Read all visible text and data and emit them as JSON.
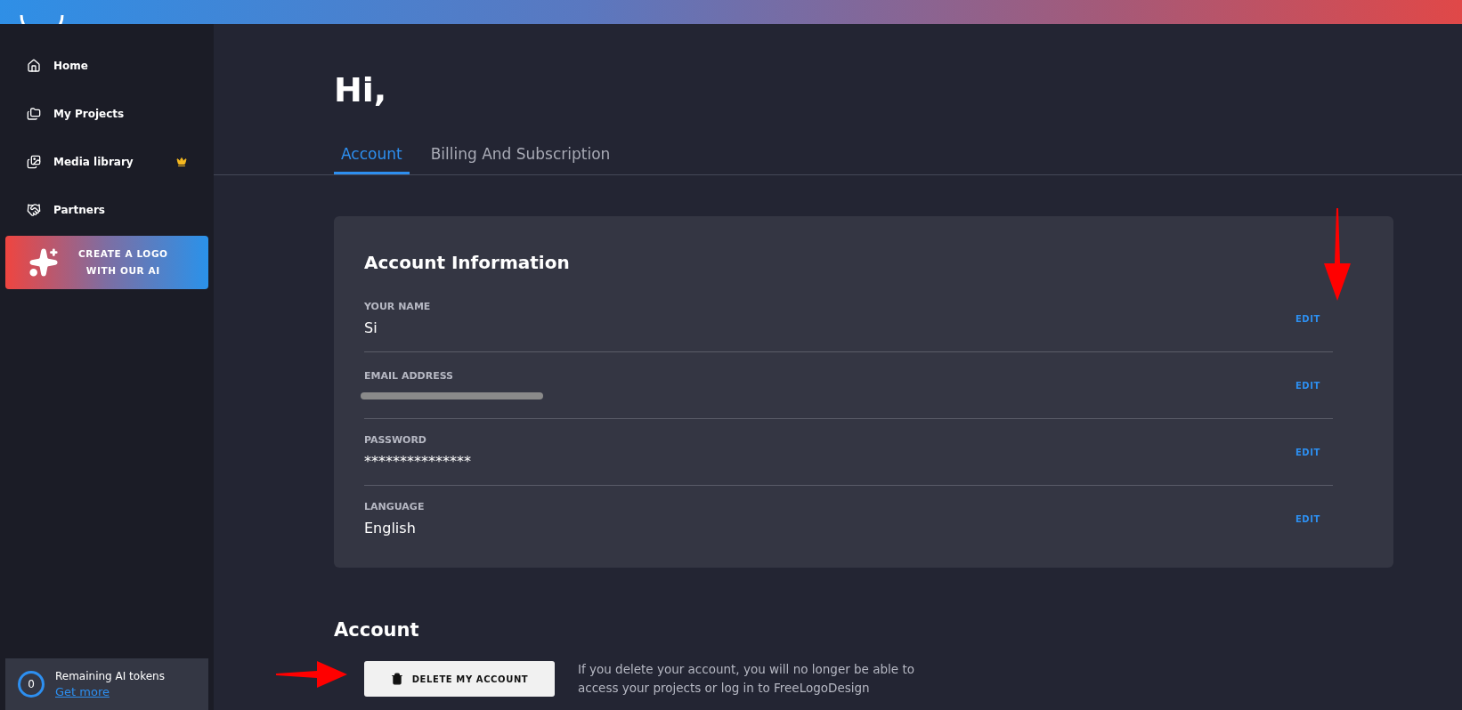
{
  "sidebar": {
    "items": [
      {
        "label": "Home",
        "kind": "home",
        "selected": false
      },
      {
        "label": "My Projects",
        "kind": "projects",
        "selected": false
      },
      {
        "label": "Media library",
        "kind": "media",
        "premium": true,
        "selected": false
      },
      {
        "label": "Partners",
        "kind": "partners",
        "selected": false
      }
    ],
    "ai_button": {
      "lines": [
        "CREATE A LOGO",
        "WITH OUR AI"
      ]
    },
    "tokens": {
      "count": "0",
      "label": "Remaining AI tokens",
      "link": "Get more"
    }
  },
  "greeting": "Hi,",
  "tabs": [
    {
      "label": "Account",
      "selected": true
    },
    {
      "label": "Billing And Subscription",
      "selected": false
    }
  ],
  "account_info": {
    "title": "Account Information",
    "rows": [
      {
        "label": "YOUR NAME",
        "value": "Si",
        "redacted": false,
        "action": "EDIT"
      },
      {
        "label": "EMAIL ADDRESS",
        "redacted": true,
        "action": "EDIT"
      },
      {
        "label": "PASSWORD",
        "value": "***************",
        "redacted": false,
        "action": "EDIT"
      },
      {
        "label": "LANGUAGE",
        "value": "English",
        "redacted": false,
        "action": "EDIT"
      }
    ]
  },
  "account": {
    "title": "Account",
    "delete_button": "DELETE MY ACCOUNT",
    "note": "If you delete your account, you will no longer be able to access your projects or log in to FreeLogoDesign"
  }
}
